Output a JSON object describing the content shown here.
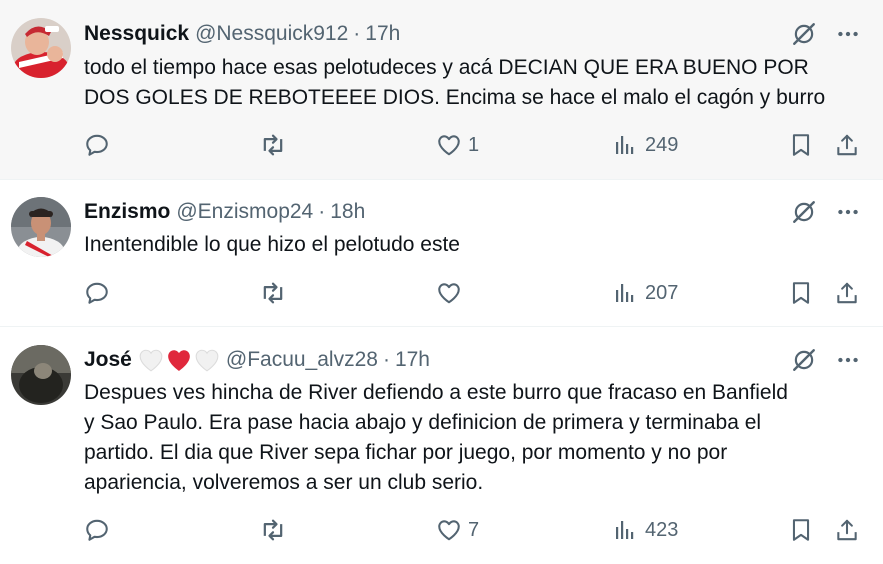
{
  "tweets": [
    {
      "name": "Nessquick",
      "handle": "@Nessquick912",
      "separator": "·",
      "time": "17h",
      "text": "todo el tiempo hace esas pelotudeces y acá DECIAN QUE ERA BUENO POR\nDOS GOLES DE REBOTEEEE DIOS. Encima se hace el malo el cagón y burro",
      "likes": "1",
      "views": "249",
      "replies": "",
      "reposts": ""
    },
    {
      "name": "Enzismo",
      "handle": "@Enzismop24",
      "separator": "·",
      "time": "18h",
      "text": "Inentendible lo que hizo el pelotudo este",
      "likes": "",
      "views": "207",
      "replies": "",
      "reposts": ""
    },
    {
      "name": "José",
      "name_emoji": [
        "white-heart",
        "red-heart",
        "white-heart"
      ],
      "handle": "@Facuu_alvz28",
      "separator": "·",
      "time": "17h",
      "text": "Despues ves hincha de River defiendo a este burro que fracaso en Banfield\ny Sao Paulo. Era pase hacia abajo y definicion de primera y terminaba el\npartido. El dia que River sepa fichar por juego, por momento y no por\napariencia, volveremos a ser un club serio.",
      "likes": "7",
      "views": "423",
      "replies": "",
      "reposts": ""
    }
  ],
  "icons": {
    "grok": "grok-icon",
    "more": "more-icon",
    "reply": "reply-icon",
    "repost": "repost-icon",
    "like": "like-icon",
    "views": "views-icon",
    "bookmark": "bookmark-icon",
    "share": "share-icon"
  },
  "colors": {
    "text": "#0f1419",
    "secondary": "#536471",
    "highlight_bg": "#f7f7f7",
    "red_heart": "#e0283c"
  }
}
